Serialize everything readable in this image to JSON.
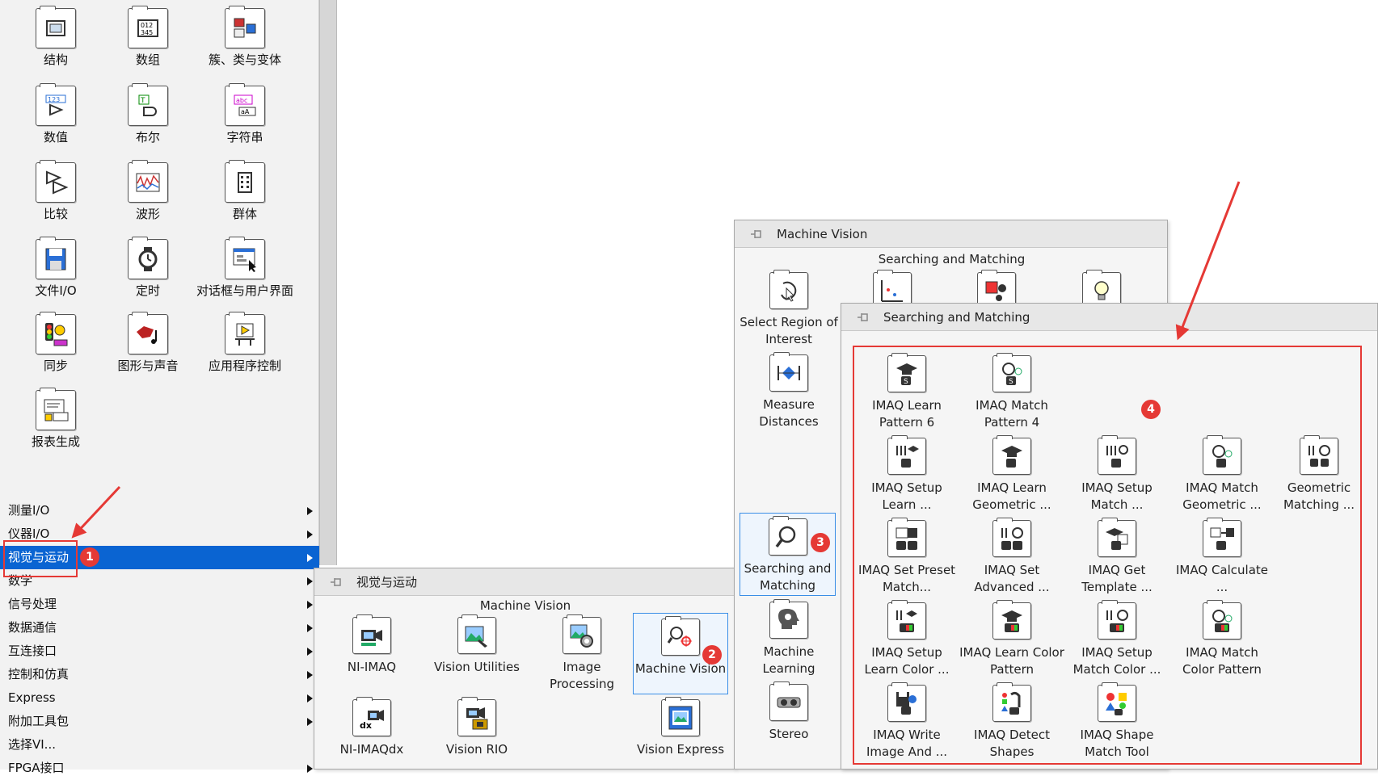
{
  "functions_palette": {
    "grid": [
      {
        "label": "结构",
        "icon": "structures-icon"
      },
      {
        "label": "数组",
        "icon": "array-icon"
      },
      {
        "label": "簇、类与变体",
        "icon": "cluster-class-variant-icon"
      },
      {
        "label": "数值",
        "icon": "numeric-icon"
      },
      {
        "label": "布尔",
        "icon": "boolean-icon"
      },
      {
        "label": "字符串",
        "icon": "string-icon"
      },
      {
        "label": "比较",
        "icon": "comparison-icon"
      },
      {
        "label": "波形",
        "icon": "waveform-icon"
      },
      {
        "label": "群体",
        "icon": "cluster-icon"
      },
      {
        "label": "文件I/O",
        "icon": "file-io-icon"
      },
      {
        "label": "定时",
        "icon": "timing-icon"
      },
      {
        "label": "对话框与用户界面",
        "icon": "dialog-ui-icon"
      },
      {
        "label": "同步",
        "icon": "synchronization-icon"
      },
      {
        "label": "图形与声音",
        "icon": "graphics-sound-icon"
      },
      {
        "label": "应用程序控制",
        "icon": "app-control-icon"
      },
      {
        "label": "报表生成",
        "icon": "report-generation-icon"
      }
    ],
    "menu": [
      {
        "label": "测量I/O"
      },
      {
        "label": "仪器I/O"
      },
      {
        "label": "视觉与运动",
        "selected": true
      },
      {
        "label": "数学"
      },
      {
        "label": "信号处理"
      },
      {
        "label": "数据通信"
      },
      {
        "label": "互连接口"
      },
      {
        "label": "控制和仿真"
      },
      {
        "label": "Express"
      },
      {
        "label": "附加工具包"
      },
      {
        "label": "选择VI..."
      },
      {
        "label": "FPGA接口"
      }
    ]
  },
  "vision_motion_palette": {
    "title": "视觉与运动",
    "section": "Machine Vision",
    "items": [
      {
        "label": "NI-IMAQ",
        "icon": "camera-icon"
      },
      {
        "label": "Vision Utilities",
        "icon": "vision-utilities-icon"
      },
      {
        "label": "Image Processing",
        "icon": "image-processing-icon"
      },
      {
        "label": "Machine Vision",
        "icon": "machine-vision-icon",
        "highlight": true
      },
      {
        "label": "NI-IMAQdx",
        "icon": "imaqdx-icon"
      },
      {
        "label": "Vision RIO",
        "icon": "vision-rio-icon"
      },
      {
        "label": "Vision Express",
        "icon": "vision-express-icon"
      }
    ]
  },
  "machine_vision_palette": {
    "title": "Machine Vision",
    "section": "Searching and Matching",
    "items": [
      {
        "label": "Select Region of Interest",
        "icon": "select-roi-icon"
      },
      {
        "label": "Measure Distances",
        "icon": "measure-distances-icon"
      },
      {
        "label": "Searching and Matching",
        "icon": "searching-matching-icon",
        "highlight": true
      },
      {
        "label": "Machine Learning",
        "icon": "machine-learning-icon"
      },
      {
        "label": "Stereo",
        "icon": "stereo-icon"
      }
    ]
  },
  "searching_matching_palette": {
    "title": "Searching and Matching",
    "items": [
      {
        "label": "IMAQ Learn Pattern 6",
        "icon": "learn-pattern-icon"
      },
      {
        "label": "IMAQ Match Pattern 4",
        "icon": "match-pattern-icon"
      },
      {
        "label": "IMAQ Setup Learn ...",
        "icon": "setup-learn-icon"
      },
      {
        "label": "IMAQ Learn Geometric ...",
        "icon": "learn-geometric-icon"
      },
      {
        "label": "IMAQ Setup Match ...",
        "icon": "setup-match-icon"
      },
      {
        "label": "IMAQ Match Geometric ...",
        "icon": "match-geometric-icon"
      },
      {
        "label": "Geometric Matching ...",
        "icon": "geometric-matching-icon"
      },
      {
        "label": "IMAQ Set Preset Match...",
        "icon": "set-preset-match-icon"
      },
      {
        "label": "IMAQ Set Advanced ...",
        "icon": "set-advanced-icon"
      },
      {
        "label": "IMAQ Get Template ...",
        "icon": "get-template-icon"
      },
      {
        "label": "IMAQ Calculate ...",
        "icon": "calculate-icon"
      },
      {
        "label": "IMAQ Setup Learn Color ...",
        "icon": "setup-learn-color-icon"
      },
      {
        "label": "IMAQ Learn Color Pattern",
        "icon": "learn-color-pattern-icon"
      },
      {
        "label": "IMAQ Setup Match Color ...",
        "icon": "setup-match-color-icon"
      },
      {
        "label": "IMAQ Match Color Pattern",
        "icon": "match-color-pattern-icon"
      },
      {
        "label": "IMAQ Write Image And ...",
        "icon": "write-image-icon"
      },
      {
        "label": "IMAQ Detect Shapes",
        "icon": "detect-shapes-icon"
      },
      {
        "label": "IMAQ Shape Match Tool",
        "icon": "shape-match-tool-icon"
      }
    ]
  },
  "annotations": {
    "badge1": "1",
    "badge2": "2",
    "badge3": "3",
    "badge4": "4",
    "color": "#e53935"
  }
}
